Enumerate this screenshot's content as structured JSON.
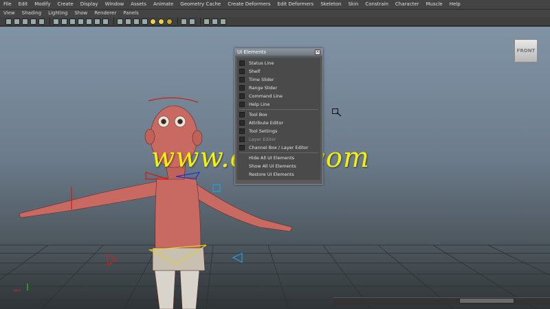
{
  "menubar": {
    "items": [
      "File",
      "Edit",
      "Modify",
      "Create",
      "Display",
      "Window",
      "Assets",
      "Animate",
      "Geometry Cache",
      "Create Deformers",
      "Edit Deformers",
      "Skeleton",
      "Skin",
      "Constrain",
      "Character",
      "Muscle",
      "Help"
    ]
  },
  "panel_menu": {
    "items": [
      "View",
      "Shading",
      "Lighting",
      "Show",
      "Renderer",
      "Panels"
    ]
  },
  "viewport": {
    "view_cube_label": "FRONT"
  },
  "watermark": "www.cgtsj.com",
  "ui_elements_dialog": {
    "title": "UI Elements",
    "close_label": "×",
    "checkbox_items": [
      {
        "label": "Status Line"
      },
      {
        "label": "Shelf"
      },
      {
        "label": "Time Slider"
      },
      {
        "label": "Range Slider"
      },
      {
        "label": "Command Line"
      },
      {
        "label": "Help Line"
      }
    ],
    "checkbox_items_2": [
      {
        "label": "Tool Box"
      },
      {
        "label": "Attribute Editor"
      },
      {
        "label": "Tool Settings"
      },
      {
        "label": "Layer Editor"
      },
      {
        "label": "Channel Box / Layer Editor"
      }
    ],
    "actions": [
      {
        "label": "Hide All UI Elements"
      },
      {
        "label": "Show All UI Elements"
      },
      {
        "label": "Restore UI Elements"
      }
    ]
  },
  "colors": {
    "menubar_bg": "#444444",
    "viewport_top": "#8093a5",
    "viewport_bottom": "#2f3436",
    "watermark": "#f5f00a",
    "character_skin": "#c86a62",
    "dialog_bg": "#5a5a5a"
  }
}
